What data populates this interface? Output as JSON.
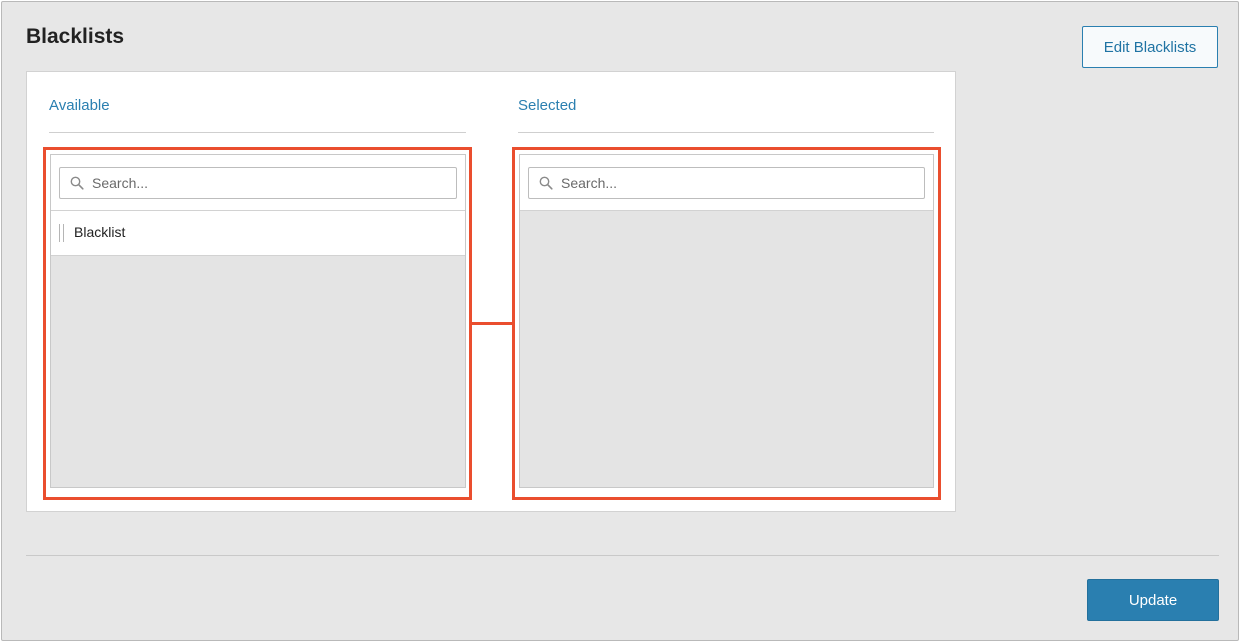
{
  "header": {
    "title": "Blacklists",
    "edit_button_label": "Edit Blacklists"
  },
  "available": {
    "title": "Available",
    "search_placeholder": "Search...",
    "items": [
      {
        "label": "Blacklist"
      }
    ]
  },
  "selected": {
    "title": "Selected",
    "search_placeholder": "Search...",
    "items": []
  },
  "footer": {
    "update_button_label": "Update"
  },
  "colors": {
    "accent": "#2a7fb0",
    "highlight": "#ea4e2e",
    "background": "#e7e7e7"
  }
}
